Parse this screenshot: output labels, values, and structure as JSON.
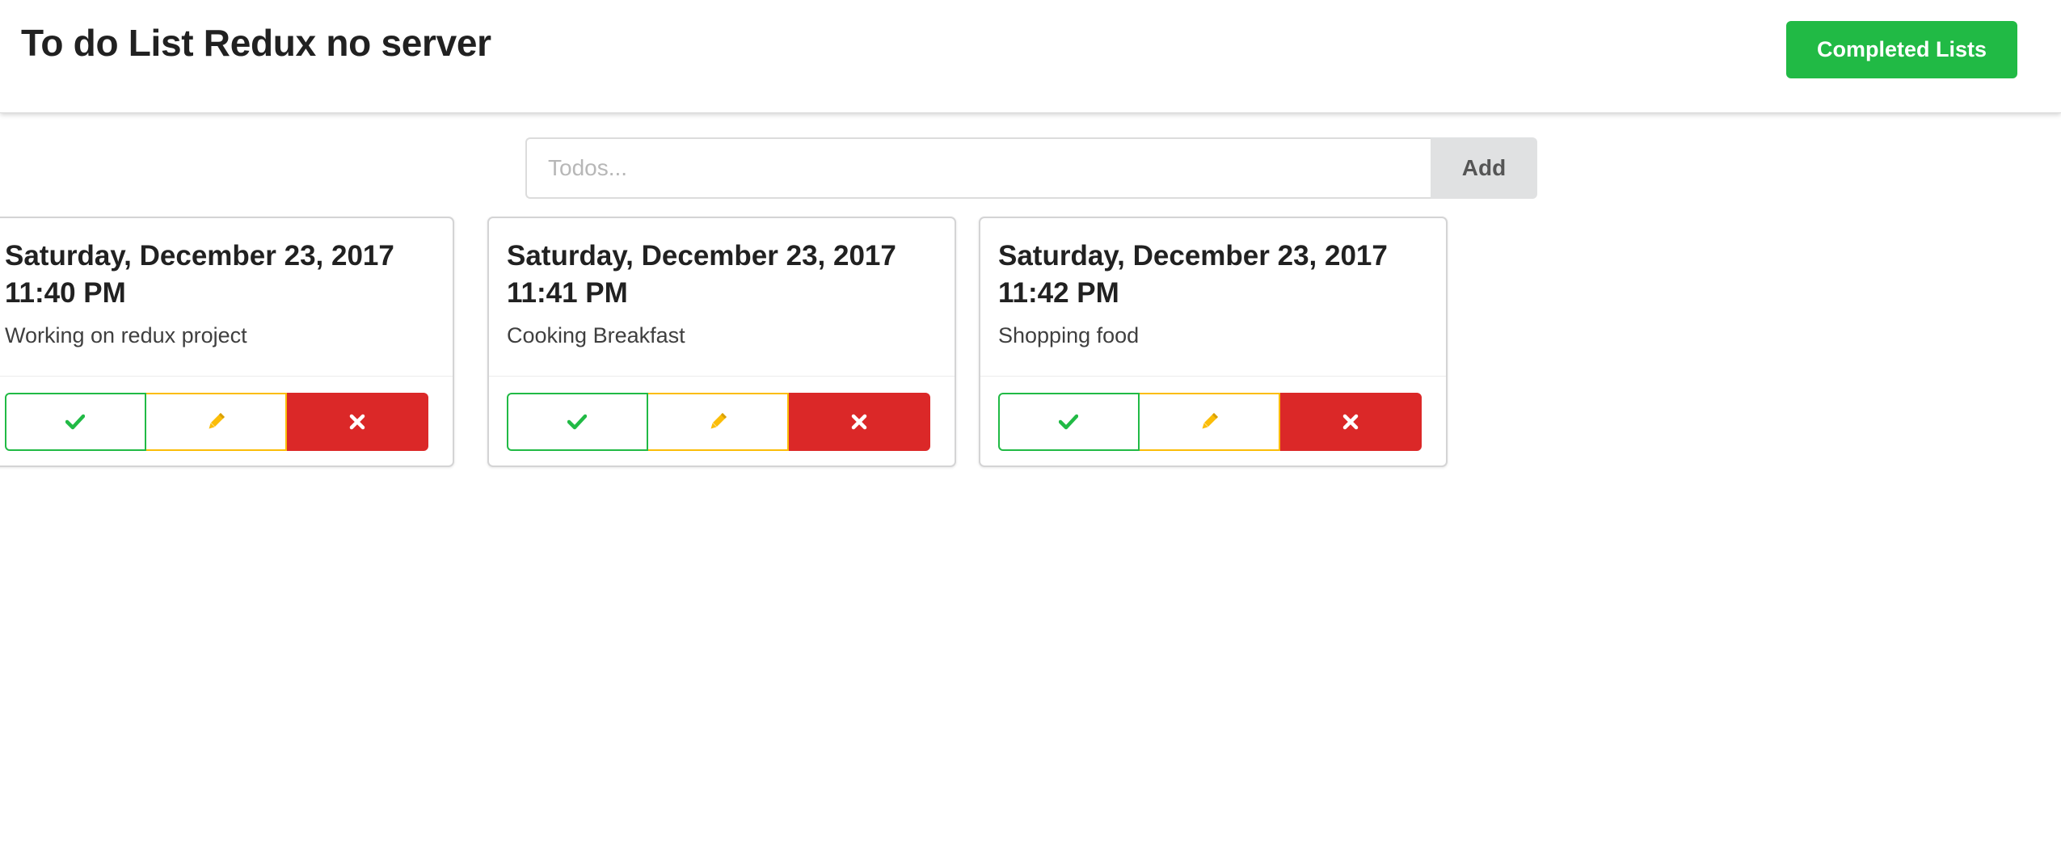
{
  "header": {
    "title": "To do List Redux no server",
    "completed_button_label": "Completed Lists"
  },
  "form": {
    "placeholder": "Todos...",
    "value": "",
    "add_label": "Add"
  },
  "colors": {
    "success": "#21ba45",
    "warning": "#fbbd08",
    "danger": "#db2828",
    "add_button_bg": "#e0e1e2"
  },
  "todos": [
    {
      "date": "Saturday, December 23, 2017 11:40 PM",
      "text": "Working on redux project",
      "actions": [
        "check-icon",
        "pencil-icon",
        "close-icon"
      ]
    },
    {
      "date": "Saturday, December 23, 2017 11:41 PM",
      "text": "Cooking Breakfast",
      "actions": [
        "check-icon",
        "pencil-icon",
        "close-icon"
      ]
    },
    {
      "date": "Saturday, December 23, 2017 11:42 PM",
      "text": "Shopping food",
      "actions": [
        "check-icon",
        "pencil-icon",
        "close-icon"
      ]
    }
  ]
}
